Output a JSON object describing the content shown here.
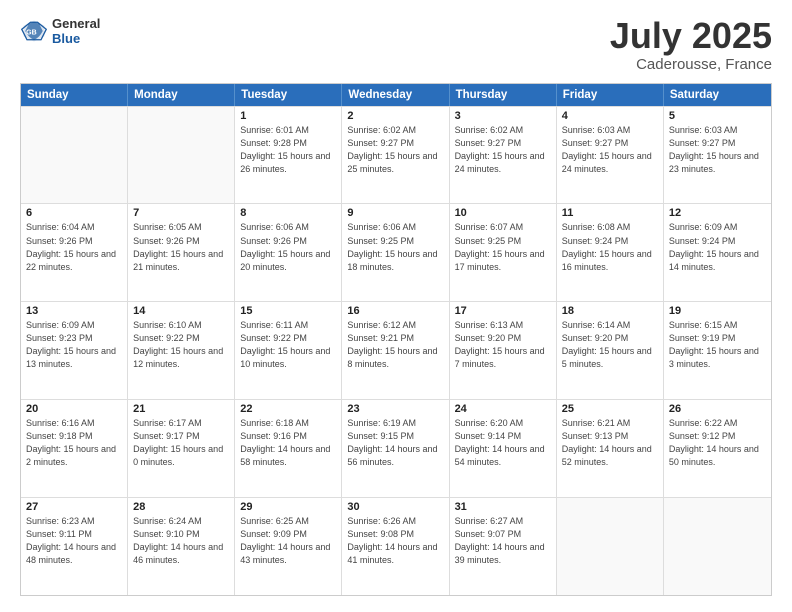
{
  "header": {
    "logo_general": "General",
    "logo_blue": "Blue",
    "title": "July 2025",
    "location": "Caderousse, France"
  },
  "days": [
    "Sunday",
    "Monday",
    "Tuesday",
    "Wednesday",
    "Thursday",
    "Friday",
    "Saturday"
  ],
  "rows": [
    [
      {
        "date": "",
        "info": ""
      },
      {
        "date": "",
        "info": ""
      },
      {
        "date": "1",
        "info": "Sunrise: 6:01 AM\nSunset: 9:28 PM\nDaylight: 15 hours\nand 26 minutes."
      },
      {
        "date": "2",
        "info": "Sunrise: 6:02 AM\nSunset: 9:27 PM\nDaylight: 15 hours\nand 25 minutes."
      },
      {
        "date": "3",
        "info": "Sunrise: 6:02 AM\nSunset: 9:27 PM\nDaylight: 15 hours\nand 24 minutes."
      },
      {
        "date": "4",
        "info": "Sunrise: 6:03 AM\nSunset: 9:27 PM\nDaylight: 15 hours\nand 24 minutes."
      },
      {
        "date": "5",
        "info": "Sunrise: 6:03 AM\nSunset: 9:27 PM\nDaylight: 15 hours\nand 23 minutes."
      }
    ],
    [
      {
        "date": "6",
        "info": "Sunrise: 6:04 AM\nSunset: 9:26 PM\nDaylight: 15 hours\nand 22 minutes."
      },
      {
        "date": "7",
        "info": "Sunrise: 6:05 AM\nSunset: 9:26 PM\nDaylight: 15 hours\nand 21 minutes."
      },
      {
        "date": "8",
        "info": "Sunrise: 6:06 AM\nSunset: 9:26 PM\nDaylight: 15 hours\nand 20 minutes."
      },
      {
        "date": "9",
        "info": "Sunrise: 6:06 AM\nSunset: 9:25 PM\nDaylight: 15 hours\nand 18 minutes."
      },
      {
        "date": "10",
        "info": "Sunrise: 6:07 AM\nSunset: 9:25 PM\nDaylight: 15 hours\nand 17 minutes."
      },
      {
        "date": "11",
        "info": "Sunrise: 6:08 AM\nSunset: 9:24 PM\nDaylight: 15 hours\nand 16 minutes."
      },
      {
        "date": "12",
        "info": "Sunrise: 6:09 AM\nSunset: 9:24 PM\nDaylight: 15 hours\nand 14 minutes."
      }
    ],
    [
      {
        "date": "13",
        "info": "Sunrise: 6:09 AM\nSunset: 9:23 PM\nDaylight: 15 hours\nand 13 minutes."
      },
      {
        "date": "14",
        "info": "Sunrise: 6:10 AM\nSunset: 9:22 PM\nDaylight: 15 hours\nand 12 minutes."
      },
      {
        "date": "15",
        "info": "Sunrise: 6:11 AM\nSunset: 9:22 PM\nDaylight: 15 hours\nand 10 minutes."
      },
      {
        "date": "16",
        "info": "Sunrise: 6:12 AM\nSunset: 9:21 PM\nDaylight: 15 hours\nand 8 minutes."
      },
      {
        "date": "17",
        "info": "Sunrise: 6:13 AM\nSunset: 9:20 PM\nDaylight: 15 hours\nand 7 minutes."
      },
      {
        "date": "18",
        "info": "Sunrise: 6:14 AM\nSunset: 9:20 PM\nDaylight: 15 hours\nand 5 minutes."
      },
      {
        "date": "19",
        "info": "Sunrise: 6:15 AM\nSunset: 9:19 PM\nDaylight: 15 hours\nand 3 minutes."
      }
    ],
    [
      {
        "date": "20",
        "info": "Sunrise: 6:16 AM\nSunset: 9:18 PM\nDaylight: 15 hours\nand 2 minutes."
      },
      {
        "date": "21",
        "info": "Sunrise: 6:17 AM\nSunset: 9:17 PM\nDaylight: 15 hours\nand 0 minutes."
      },
      {
        "date": "22",
        "info": "Sunrise: 6:18 AM\nSunset: 9:16 PM\nDaylight: 14 hours\nand 58 minutes."
      },
      {
        "date": "23",
        "info": "Sunrise: 6:19 AM\nSunset: 9:15 PM\nDaylight: 14 hours\nand 56 minutes."
      },
      {
        "date": "24",
        "info": "Sunrise: 6:20 AM\nSunset: 9:14 PM\nDaylight: 14 hours\nand 54 minutes."
      },
      {
        "date": "25",
        "info": "Sunrise: 6:21 AM\nSunset: 9:13 PM\nDaylight: 14 hours\nand 52 minutes."
      },
      {
        "date": "26",
        "info": "Sunrise: 6:22 AM\nSunset: 9:12 PM\nDaylight: 14 hours\nand 50 minutes."
      }
    ],
    [
      {
        "date": "27",
        "info": "Sunrise: 6:23 AM\nSunset: 9:11 PM\nDaylight: 14 hours\nand 48 minutes."
      },
      {
        "date": "28",
        "info": "Sunrise: 6:24 AM\nSunset: 9:10 PM\nDaylight: 14 hours\nand 46 minutes."
      },
      {
        "date": "29",
        "info": "Sunrise: 6:25 AM\nSunset: 9:09 PM\nDaylight: 14 hours\nand 43 minutes."
      },
      {
        "date": "30",
        "info": "Sunrise: 6:26 AM\nSunset: 9:08 PM\nDaylight: 14 hours\nand 41 minutes."
      },
      {
        "date": "31",
        "info": "Sunrise: 6:27 AM\nSunset: 9:07 PM\nDaylight: 14 hours\nand 39 minutes."
      },
      {
        "date": "",
        "info": ""
      },
      {
        "date": "",
        "info": ""
      }
    ]
  ]
}
